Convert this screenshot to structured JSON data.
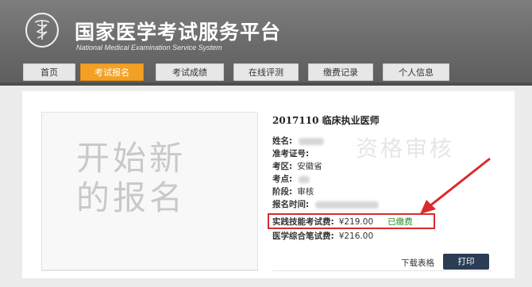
{
  "header": {
    "title_cn": "国家医学考试服务平台",
    "title_en": "National Medical Examination Service System"
  },
  "nav": {
    "tabs": [
      {
        "label": "首页"
      },
      {
        "label": "考试报名",
        "active": true
      },
      {
        "label": "考试成绩"
      },
      {
        "label": "在线评测"
      },
      {
        "label": "缴费记录"
      },
      {
        "label": "个人信息"
      }
    ]
  },
  "start_card": {
    "line1": "开始新",
    "line2": "的报名"
  },
  "exam": {
    "title": "2017110 临床执业医师",
    "watermark": "资格审核",
    "fields": {
      "name_label": "姓名:",
      "ticket_label": "准考证号:",
      "area_label": "考区:",
      "area_value": "安徽省",
      "site_label": "考点:",
      "stage_label": "阶段:",
      "stage_value": "审核",
      "time_label": "报名时间:",
      "practice_fee_label": "实践技能考试费:",
      "practice_fee_value": "¥219.00",
      "practice_fee_status": "已缴费",
      "written_fee_label": "医学综合笔试费:",
      "written_fee_value": "¥216.00"
    },
    "download_label": "下载表格",
    "print_label": "打印"
  },
  "colors": {
    "active_tab": "#f3a125",
    "highlight_box": "#d92b2b",
    "paid_status": "#2a8a2a",
    "print_button": "#2a3d55"
  }
}
